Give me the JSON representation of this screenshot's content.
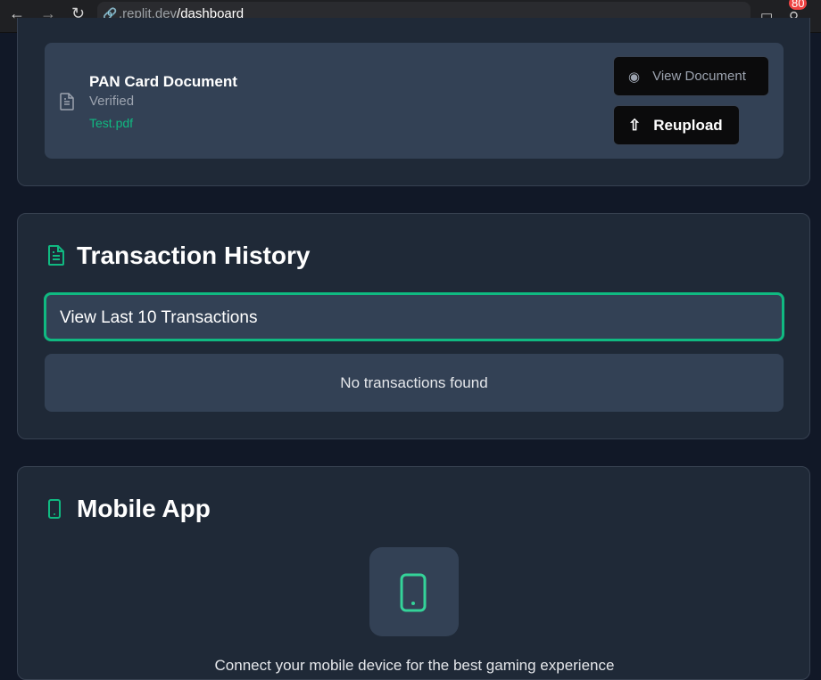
{
  "browser": {
    "url_host": ".replit.dev",
    "url_path": "/dashboard",
    "badge": "80"
  },
  "document": {
    "title": "PAN Card Document",
    "status": "Verified",
    "file": "Test.pdf",
    "view_label": "View Document",
    "reupload_label": "Reupload"
  },
  "transactions": {
    "title": "Transaction History",
    "dropdown": "View Last 10 Transactions",
    "empty": "No transactions found"
  },
  "mobile": {
    "title": "Mobile App",
    "text": "Connect your mobile device for the best gaming experience"
  },
  "colors": {
    "accent": "#10b981",
    "page_bg": "#111827",
    "card_bg": "#1f2937",
    "inner_bg": "#334155"
  }
}
